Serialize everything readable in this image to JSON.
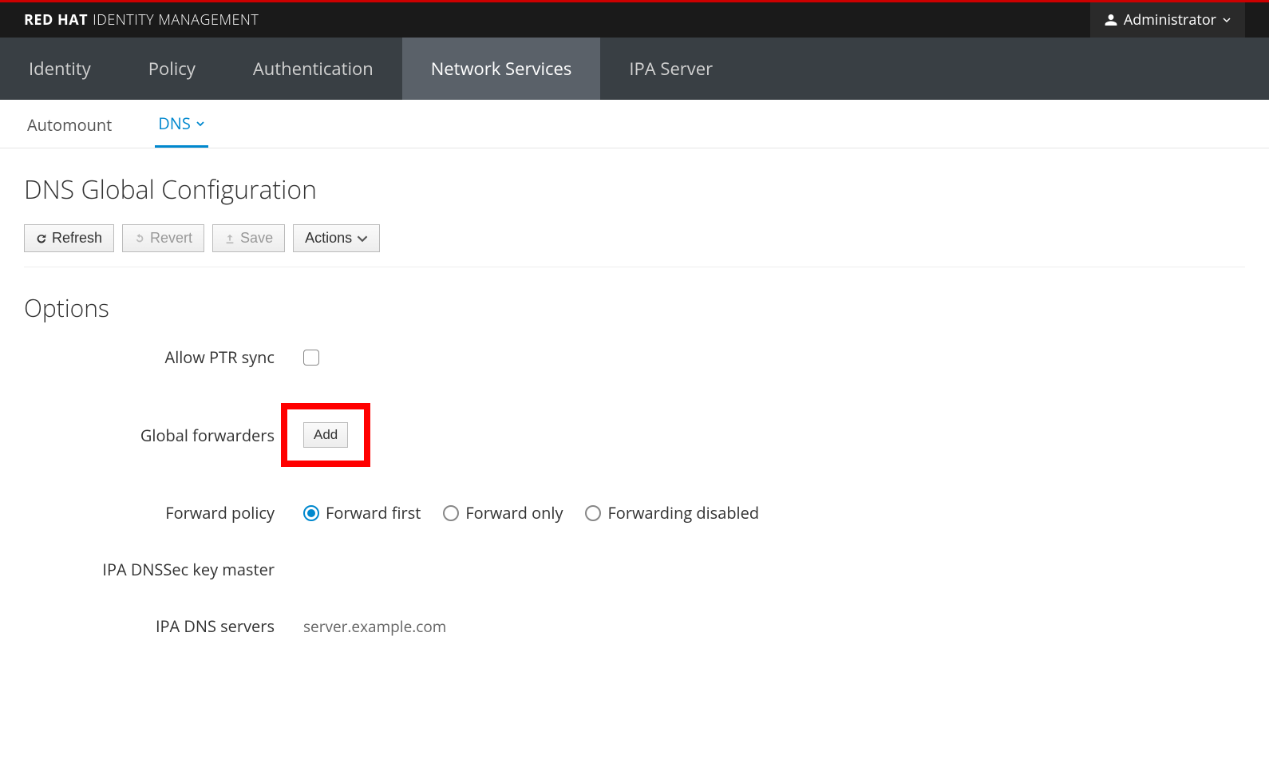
{
  "brand": {
    "red": "RED HAT",
    "rest": "IDENTITY MANAGEMENT"
  },
  "user": {
    "name": "Administrator"
  },
  "main_nav": {
    "items": [
      {
        "label": "Identity",
        "active": false
      },
      {
        "label": "Policy",
        "active": false
      },
      {
        "label": "Authentication",
        "active": false
      },
      {
        "label": "Network Services",
        "active": true
      },
      {
        "label": "IPA Server",
        "active": false
      }
    ]
  },
  "sub_nav": {
    "items": [
      {
        "label": "Automount",
        "active": false,
        "dropdown": false
      },
      {
        "label": "DNS",
        "active": true,
        "dropdown": true
      }
    ]
  },
  "page": {
    "title": "DNS Global Configuration"
  },
  "toolbar": {
    "refresh": "Refresh",
    "revert": "Revert",
    "save": "Save",
    "actions": "Actions"
  },
  "section": {
    "options_title": "Options"
  },
  "form": {
    "allow_ptr_sync": {
      "label": "Allow PTR sync",
      "checked": false
    },
    "global_forwarders": {
      "label": "Global forwarders",
      "add_button": "Add"
    },
    "forward_policy": {
      "label": "Forward policy",
      "options": [
        {
          "label": "Forward first",
          "selected": true
        },
        {
          "label": "Forward only",
          "selected": false
        },
        {
          "label": "Forwarding disabled",
          "selected": false
        }
      ]
    },
    "dnssec_key_master": {
      "label": "IPA DNSSec key master",
      "value": ""
    },
    "ipa_dns_servers": {
      "label": "IPA DNS servers",
      "value": "server.example.com"
    }
  }
}
